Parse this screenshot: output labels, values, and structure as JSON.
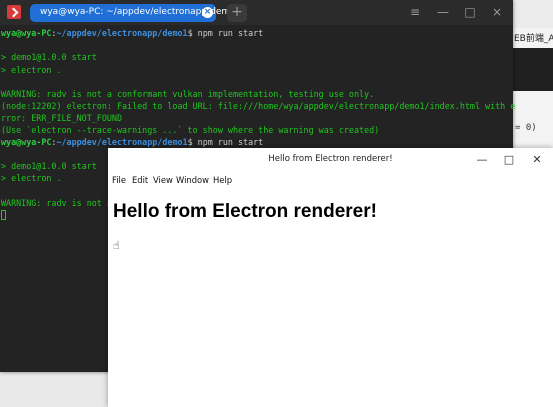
{
  "background": {
    "tab_text": "EB前端_All",
    "code_text": "= 0)"
  },
  "terminal": {
    "tab_title": "wya@wya-PC: ~/appdev/electronapp/demo1",
    "tab_close_icon": "close-icon",
    "new_tab_icon": "plus-icon",
    "controls": {
      "menu": "≡",
      "minimize": "—",
      "maximize": "□",
      "close": "×"
    },
    "lines": [
      {
        "prompt": "wya@wya-PC",
        "sep": ":",
        "path": "~/appdev/electronapp/demo1",
        "cmd": "$ npm run start"
      },
      {
        "text": ""
      },
      {
        "text": "> demo1@1.0.0 start"
      },
      {
        "text": "> electron ."
      },
      {
        "text": ""
      },
      {
        "text": "WARNING: radv is not a conformant vulkan implementation, testing use only."
      },
      {
        "text": "(node:12202) electron: Failed to load URL: file:///home/wya/appdev/electronapp/demo1/index.html with e"
      },
      {
        "text": "rror: ERR_FILE_NOT_FOUND"
      },
      {
        "text": "(Use `electron --trace-warnings ...` to show where the warning was created)"
      },
      {
        "prompt": "wya@wya-PC",
        "sep": ":",
        "path": "~/appdev/electronapp/demo1",
        "cmd": "$ npm run start"
      },
      {
        "text": ""
      },
      {
        "text": "> demo1@1.0.0 start"
      },
      {
        "text": "> electron ."
      },
      {
        "text": ""
      },
      {
        "text": "WARNING: radv is not a"
      }
    ]
  },
  "electron": {
    "window_title": "Hello from Electron renderer!",
    "controls": {
      "minimize": "—",
      "maximize": "□",
      "close": "✕"
    },
    "menu": [
      "File",
      "Edit",
      "View",
      "Window",
      "Help"
    ],
    "heading": "Hello from Electron renderer!"
  }
}
